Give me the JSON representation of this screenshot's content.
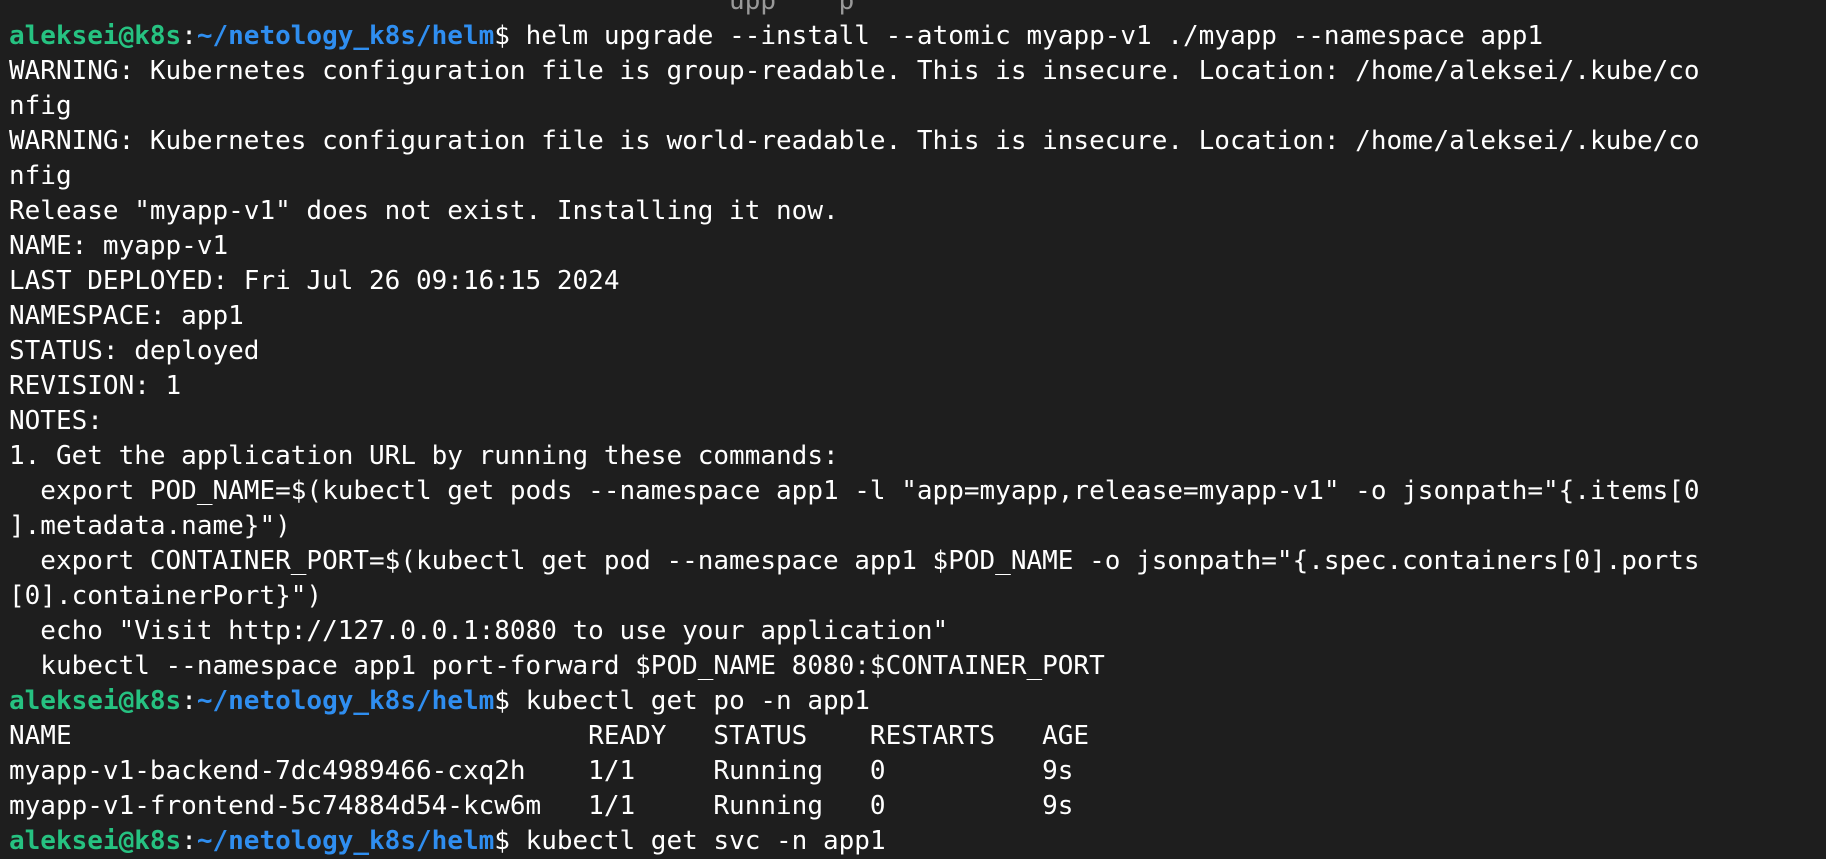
{
  "terminal": {
    "prompt": {
      "user": "aleksei@k8s",
      "sep": ":",
      "path": "~/netology_k8s/helm",
      "symbol": "$ "
    },
    "top_partial_line": "                                              upp    p",
    "commands": [
      "helm upgrade --install --atomic myapp-v1 ./myapp --namespace app1",
      "kubectl get po -n app1",
      "kubectl get svc -n app1"
    ],
    "output_block_1": [
      "WARNING: Kubernetes configuration file is group-readable. This is insecure. Location: /home/aleksei/.kube/co",
      "nfig",
      "WARNING: Kubernetes configuration file is world-readable. This is insecure. Location: /home/aleksei/.kube/co",
      "nfig",
      "Release \"myapp-v1\" does not exist. Installing it now.",
      "NAME: myapp-v1",
      "LAST DEPLOYED: Fri Jul 26 09:16:15 2024",
      "NAMESPACE: app1",
      "STATUS: deployed",
      "REVISION: 1",
      "NOTES:",
      "1. Get the application URL by running these commands:",
      "  export POD_NAME=$(kubectl get pods --namespace app1 -l \"app=myapp,release=myapp-v1\" -o jsonpath=\"{.items[0",
      "].metadata.name}\")",
      "  export CONTAINER_PORT=$(kubectl get pod --namespace app1 $POD_NAME -o jsonpath=\"{.spec.containers[0].ports",
      "[0].containerPort}\")",
      "  echo \"Visit http://127.0.0.1:8080 to use your application\"",
      "  kubectl --namespace app1 port-forward $POD_NAME 8080:$CONTAINER_PORT"
    ],
    "pods_table": {
      "header": "NAME                                 READY   STATUS    RESTARTS   AGE",
      "rows": [
        "myapp-v1-backend-7dc4989466-cxq2h    1/1     Running   0          9s",
        "myapp-v1-frontend-5c74884d54-kcw6m   1/1     Running   0          9s"
      ]
    }
  }
}
